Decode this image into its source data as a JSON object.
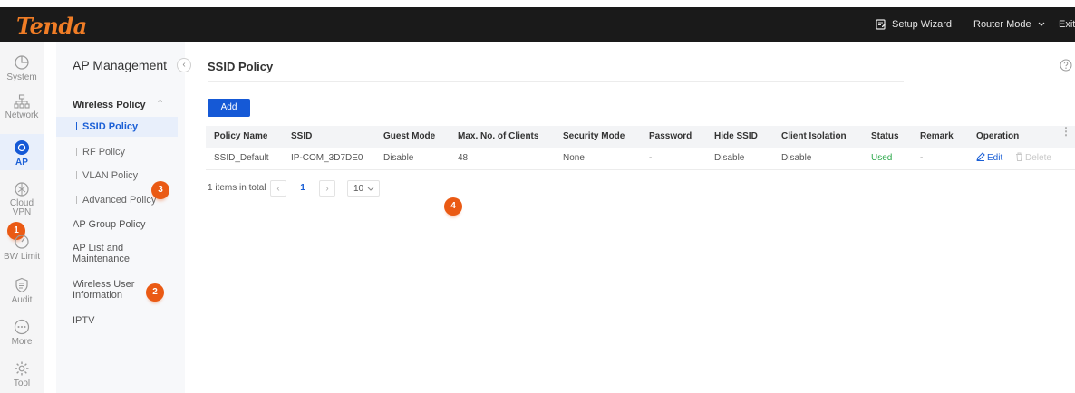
{
  "brand": {
    "logo_text": "Tenda",
    "logo_color": "#f07d26"
  },
  "topnav": {
    "setup_wizard": "Setup Wizard",
    "router_mode": "Router Mode",
    "exit": "Exit"
  },
  "iconbar": {
    "items": [
      {
        "label": "System",
        "icon": "pie-chart-icon"
      },
      {
        "label": "Network",
        "icon": "network-tree-icon"
      },
      {
        "label": "AP",
        "icon": "ap-icon",
        "active": true
      },
      {
        "label": "Cloud VPN",
        "icon": "cloud-vpn-icon"
      },
      {
        "label": "BW Limit",
        "icon": "speedometer-icon"
      },
      {
        "label": "Audit",
        "icon": "audit-shield-icon"
      },
      {
        "label": "More",
        "icon": "more-icon"
      },
      {
        "label": "Tool",
        "icon": "gear-icon"
      }
    ]
  },
  "sidepanel": {
    "title": "AP Management",
    "group": "Wireless Policy",
    "sub_items": [
      "SSID Policy",
      "RF Policy",
      "VLAN Policy",
      "Advanced Policy"
    ],
    "items": [
      "AP Group Policy",
      "AP List and Maintenance",
      "Wireless User Information",
      "IPTV"
    ]
  },
  "main": {
    "title": "SSID Policy",
    "add_label": "Add",
    "columns": [
      "Policy Name",
      "SSID",
      "Guest Mode",
      "Max. No. of Clients",
      "Security Mode",
      "Password",
      "Hide SSID",
      "Client Isolation",
      "Status",
      "Remark",
      "Operation"
    ],
    "rows": [
      {
        "policy_name": "SSID_Default",
        "ssid": "IP-COM_3D7DE0",
        "guest_mode": "Disable",
        "max_clients": "48",
        "security_mode": "None",
        "password": "-",
        "hide_ssid": "Disable",
        "client_isolation": "Disable",
        "status": "Used",
        "remark": "-",
        "edit": "Edit",
        "delete": "Delete"
      }
    ],
    "pager": {
      "total": "1 items in total",
      "current_page": "1",
      "page_size": "10"
    }
  },
  "callouts": [
    "1",
    "2",
    "3",
    "4"
  ],
  "colors": {
    "accent": "#1559d6",
    "status_used": "#2ba84a",
    "callout": "#ea5a14"
  }
}
